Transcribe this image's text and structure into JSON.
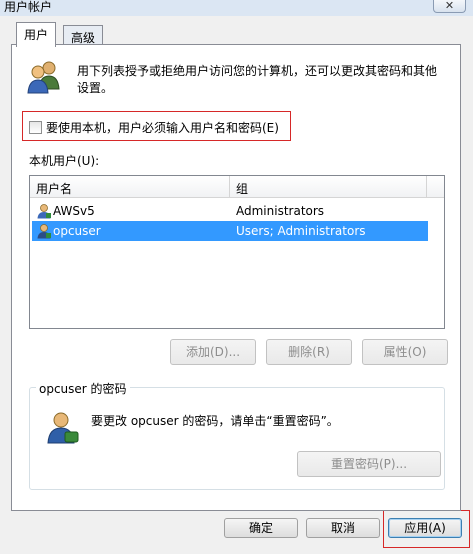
{
  "window": {
    "title": "用户帐户",
    "close_glyph": "✕"
  },
  "tabs": [
    {
      "label": "用户",
      "active": true
    },
    {
      "label": "高级",
      "active": false
    }
  ],
  "intro": {
    "text_line1": "用下列表授予或拒绝用户访问您的计算机，还可以更改其密码和其他",
    "text_line2": "设置。",
    "icon": "users-icon"
  },
  "require_password": {
    "label": "要使用本机，用户必须输入用户名和密码(E)",
    "checked": false
  },
  "users_list": {
    "label": "本机用户(U):",
    "columns": [
      "用户名",
      "组"
    ],
    "rows": [
      {
        "name": "AWSv5",
        "group": "Administrators",
        "selected": false,
        "icon": "user-icon"
      },
      {
        "name": "opcuser",
        "group": "Users; Administrators",
        "selected": true,
        "icon": "user-icon"
      }
    ]
  },
  "list_buttons": {
    "add": "添加(D)...",
    "remove": "删除(R)",
    "properties": "属性(O)"
  },
  "password_group": {
    "title": "opcuser 的密码",
    "text": "要更改 opcuser 的密码，请单击“重置密码”。",
    "reset_button": "重置密码(P)...",
    "icon": "user-key-icon"
  },
  "dialog_buttons": {
    "ok": "确定",
    "cancel": "取消",
    "apply": "应用(A)"
  },
  "colors": {
    "selection": "#3399ff",
    "highlight_box": "#d62828"
  }
}
